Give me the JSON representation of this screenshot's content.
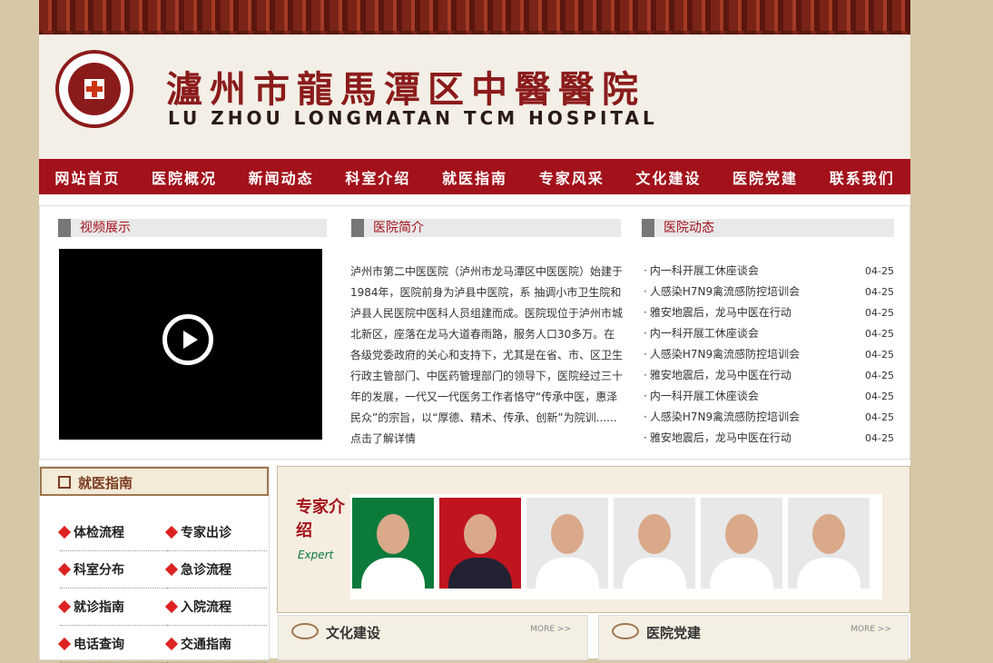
{
  "header": {
    "title_cn": "瀘州市龍馬潭区中醫醫院",
    "title_en": "LU ZHOU LONGMATAN TCM HOSPITAL"
  },
  "nav": [
    "网站首页",
    "医院概况",
    "新闻动态",
    "科室介绍",
    "就医指南",
    "专家风采",
    "文化建设",
    "医院党建",
    "联系我们"
  ],
  "video": {
    "title": "视频展示"
  },
  "intro": {
    "title": "医院简介",
    "text": "泸州市第二中医医院（泸州市龙马潭区中医医院）始建于1984年，医院前身为泸县中医院，系 抽调小市卫生院和泸县人民医院中医科人员组建而成。医院现位于泸州市城北新区，座落在龙马大道春雨路，服务人口30多万。在各级党委政府的关心和支持下，尤其是在省、市、区卫生行政主管部门、中医药管理部门的领导下，医院经过三十年的发展，一代又一代医务工作者恪守“传承中医，惠泽民众”的宗旨，以“厚德、精术、传承、创新”为院训......点击了解详情"
  },
  "news": {
    "title": "医院动态",
    "items": [
      {
        "t": "内一科开展工休座谈会",
        "d": "04-25"
      },
      {
        "t": "人感染H7N9禽流感防控培训会",
        "d": "04-25"
      },
      {
        "t": "雅安地震后，龙马中医在行动",
        "d": "04-25"
      },
      {
        "t": "内一科开展工休座谈会",
        "d": "04-25"
      },
      {
        "t": "人感染H7N9禽流感防控培训会",
        "d": "04-25"
      },
      {
        "t": "雅安地震后，龙马中医在行动",
        "d": "04-25"
      },
      {
        "t": "内一科开展工休座谈会",
        "d": "04-25"
      },
      {
        "t": "人感染H7N9禽流感防控培训会",
        "d": "04-25"
      },
      {
        "t": "雅安地震后，龙马中医在行动",
        "d": "04-25"
      }
    ]
  },
  "guide": {
    "title": "就医指南",
    "items": [
      "体检流程",
      "专家出诊",
      "科室分布",
      "急诊流程",
      "就诊指南",
      "入院流程",
      "电话查询",
      "交通指南"
    ]
  },
  "expert": {
    "title": "专家介绍",
    "expert_en": "Expert"
  },
  "culture": {
    "title": "文化建设",
    "more": "MORE >>"
  },
  "party": {
    "title": "医院党建",
    "more": "MORE >>"
  },
  "colors": {
    "nav": "#a3111b",
    "accent": "#8b1b1b"
  }
}
